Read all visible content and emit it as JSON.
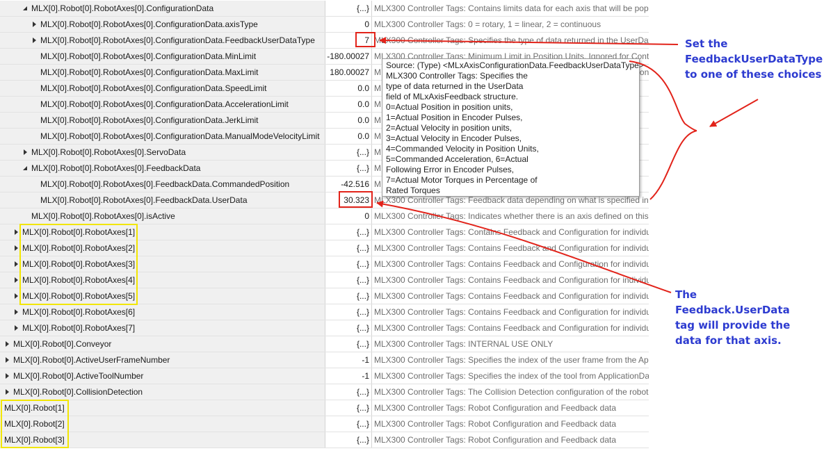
{
  "rows": [
    {
      "indent": 2,
      "expander": "expanded",
      "name": "MLX[0].Robot[0].RobotAxes[0].ConfigurationData",
      "value": "{...}",
      "description": "MLX300 Controller Tags: Contains limits data for each axis that will be popu"
    },
    {
      "indent": 3,
      "expander": "collapsed",
      "name": "MLX[0].Robot[0].RobotAxes[0].ConfigurationData.axisType",
      "value": "0",
      "description": "MLX300 Controller Tags: 0 = rotary, 1 = linear, 2 = continuous"
    },
    {
      "indent": 3,
      "expander": "collapsed",
      "name": "MLX[0].Robot[0].RobotAxes[0].ConfigurationData.FeedbackUserDataType",
      "value": "7",
      "description": "MLX300 Controller Tags: Specifies the type of data returned in the UserData"
    },
    {
      "indent": 3,
      "expander": "none",
      "name": "MLX[0].Robot[0].RobotAxes[0].ConfigurationData.MinLimit",
      "value": "-180.00027",
      "description": "MLX300 Controller Tags: Minimum Limit in Position Units. Ignored for Cont"
    },
    {
      "indent": 3,
      "expander": "none",
      "name": "MLX[0].Robot[0].RobotAxes[0].ConfigurationData.MaxLimit",
      "value": "180.00027",
      "description": "MLX300 Controller Tags: Maximum Limit in Position Units. Ignored for Cont"
    },
    {
      "indent": 3,
      "expander": "none",
      "name": "MLX[0].Robot[0].RobotAxes[0].ConfigurationData.SpeedLimit",
      "value": "0.0",
      "description": "MLX300 Controller Tags: Speed Limit in Position Units per second"
    },
    {
      "indent": 3,
      "expander": "none",
      "name": "MLX[0].Robot[0].RobotAxes[0].ConfigurationData.AccelerationLimit",
      "value": "0.0",
      "description": "MLX300 Controller Tags: Acceleration Limit in Position Units"
    },
    {
      "indent": 3,
      "expander": "none",
      "name": "MLX[0].Robot[0].RobotAxes[0].ConfigurationData.JerkLimit",
      "value": "0.0",
      "description": "MLX300 Controller Tags: Jerk Limit in Position Units"
    },
    {
      "indent": 3,
      "expander": "none",
      "name": "MLX[0].Robot[0].RobotAxes[0].ConfigurationData.ManualModeVelocityLimit",
      "value": "0.0",
      "description": "MLX300 Controller Tags: Manual Mode Velocity Limit in Position Units"
    },
    {
      "indent": 2,
      "expander": "collapsed",
      "name": "MLX[0].Robot[0].RobotAxes[0].ServoData",
      "value": "{...}",
      "description": "MLX300 Controller Tags: Servo data will be populated by"
    },
    {
      "indent": 2,
      "expander": "expanded",
      "name": "MLX[0].Robot[0].RobotAxes[0].FeedbackData",
      "value": "{...}",
      "description": "MLX300 Controller Tags: Feedback data for the axis"
    },
    {
      "indent": 3,
      "expander": "none",
      "name": "MLX[0].Robot[0].RobotAxes[0].FeedbackData.CommandedPosition",
      "value": "-42.516",
      "description": "MLX300 Controller Tags: Commanded Position in Position Un"
    },
    {
      "indent": 3,
      "expander": "none",
      "name": "MLX[0].Robot[0].RobotAxes[0].FeedbackData.UserData",
      "value": "30.323",
      "description": "MLX300 Controller Tags: Feedback data depending on what is specified in M"
    },
    {
      "indent": 2,
      "expander": "none",
      "name": "MLX[0].Robot[0].RobotAxes[0].isActive",
      "value": "0",
      "description": "MLX300 Controller Tags: Indicates whether there is an axis defined on this sl"
    },
    {
      "indent": 1,
      "expander": "collapsed",
      "name": "MLX[0].Robot[0].RobotAxes[1]",
      "value": "{...}",
      "description": "MLX300 Controller Tags: Contains Feedback and Configuration for individua"
    },
    {
      "indent": 1,
      "expander": "collapsed",
      "name": "MLX[0].Robot[0].RobotAxes[2]",
      "value": "{...}",
      "description": "MLX300 Controller Tags: Contains Feedback and Configuration for individua"
    },
    {
      "indent": 1,
      "expander": "collapsed",
      "name": "MLX[0].Robot[0].RobotAxes[3]",
      "value": "{...}",
      "description": "MLX300 Controller Tags: Contains Feedback and Configuration for individua"
    },
    {
      "indent": 1,
      "expander": "collapsed",
      "name": "MLX[0].Robot[0].RobotAxes[4]",
      "value": "{...}",
      "description": "MLX300 Controller Tags: Contains Feedback and Configuration for individua"
    },
    {
      "indent": 1,
      "expander": "collapsed",
      "name": "MLX[0].Robot[0].RobotAxes[5]",
      "value": "{...}",
      "description": "MLX300 Controller Tags: Contains Feedback and Configuration for individua"
    },
    {
      "indent": 1,
      "expander": "collapsed",
      "name": "MLX[0].Robot[0].RobotAxes[6]",
      "value": "{...}",
      "description": "MLX300 Controller Tags: Contains Feedback and Configuration for individua"
    },
    {
      "indent": 1,
      "expander": "collapsed",
      "name": "MLX[0].Robot[0].RobotAxes[7]",
      "value": "{...}",
      "description": "MLX300 Controller Tags: Contains Feedback and Configuration for individua"
    },
    {
      "indent": 0,
      "expander": "collapsed",
      "name": "MLX[0].Robot[0].Conveyor",
      "value": "{...}",
      "description": "MLX300 Controller Tags: INTERNAL USE ONLY"
    },
    {
      "indent": 0,
      "expander": "collapsed",
      "name": "MLX[0].Robot[0].ActiveUserFrameNumber",
      "value": "-1",
      "description": "MLX300 Controller Tags: Specifies the index of the user frame from the Appl"
    },
    {
      "indent": 0,
      "expander": "collapsed",
      "name": "MLX[0].Robot[0].ActiveToolNumber",
      "value": "-1",
      "description": "MLX300 Controller Tags: Specifies the index of the tool from ApplicationDat"
    },
    {
      "indent": 0,
      "expander": "collapsed",
      "name": "MLX[0].Robot[0].CollisionDetection",
      "value": "{...}",
      "description": "MLX300 Controller Tags: The Collision Detection configuration of the robot."
    },
    {
      "indent": -1,
      "expander": "none",
      "name": "MLX[0].Robot[1]",
      "value": "{...}",
      "description": "MLX300 Controller Tags: Robot Configuration and Feedback data"
    },
    {
      "indent": -1,
      "expander": "none",
      "name": "MLX[0].Robot[2]",
      "value": "{...}",
      "description": "MLX300 Controller Tags: Robot Configuration and Feedback data"
    },
    {
      "indent": -1,
      "expander": "none",
      "name": "MLX[0].Robot[3]",
      "value": "{...}",
      "description": "MLX300 Controller Tags: Robot Configuration and Feedback data"
    }
  ],
  "tooltip": {
    "lines": [
      "Source: (Type) <MLxAxisConfigurationData.FeedbackUserDataType>",
      "MLX300 Controller Tags: Specifies the",
      "type of data returned in the UserData",
      "field of MLxAxisFeedback structure.",
      "0=Actual Position in position units,",
      "1=Actual Position in Encoder Pulses,",
      "2=Actual Velocity in position units,",
      "3=Actual Velocity in Encoder Pulses,",
      "4=Commanded Velocity in Position Units,",
      "5=Commanded Acceleration, 6=Actual",
      "Following Error in Encoder Pulses,",
      "7=Actual Motor Torques in Percentage of",
      "Rated Torques"
    ]
  },
  "annotations": {
    "top": [
      "Set the",
      "FeedbackUserDataType",
      "to one of these choices"
    ],
    "bottom": [
      "The",
      "Feedback.UserData",
      "tag will provide the",
      "data for that axis."
    ]
  },
  "colors": {
    "annotation_text": "#2d3bd0",
    "highlight_red": "#e2231a",
    "highlight_yellow": "#f2e600"
  }
}
